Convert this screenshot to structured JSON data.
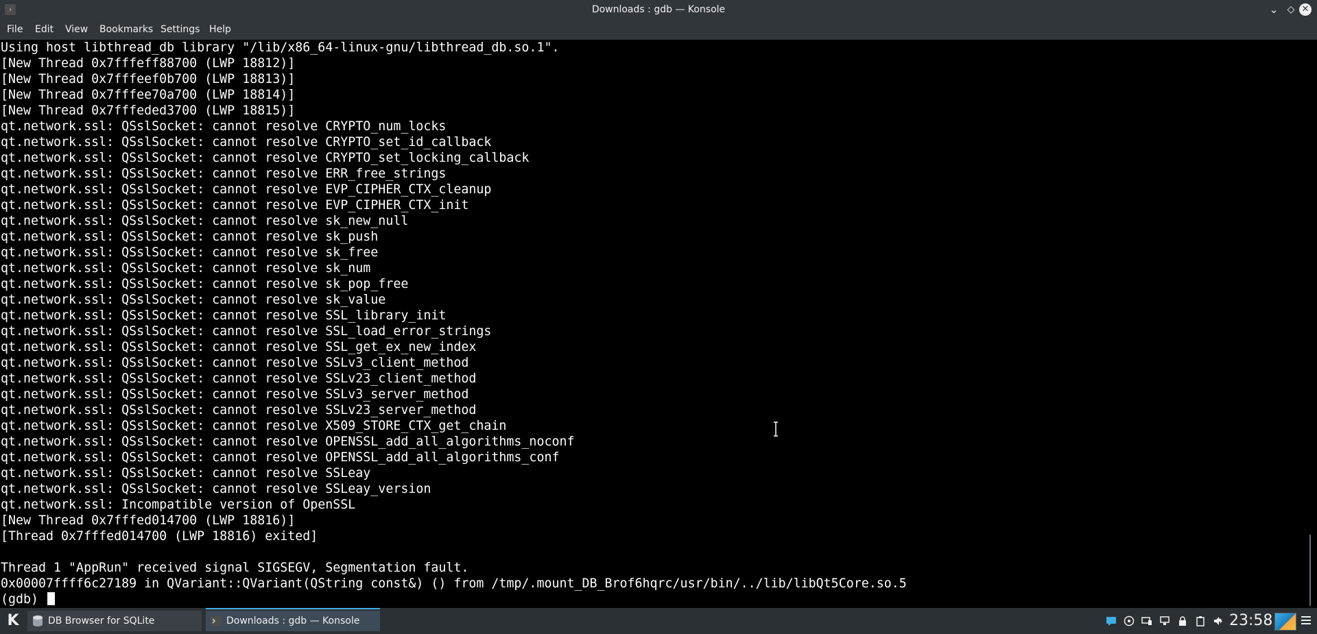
{
  "window": {
    "title": "Downloads : gdb — Konsole",
    "app_icon": "terminal-icon",
    "minimize_glyph": "⌄",
    "maximize_glyph": "◇",
    "close_glyph": "✕"
  },
  "menubar": {
    "items": [
      "File",
      "Edit",
      "View",
      "Bookmarks",
      "Settings",
      "Help"
    ]
  },
  "terminal": {
    "lines": [
      "Using host libthread_db library \"/lib/x86_64-linux-gnu/libthread_db.so.1\".",
      "[New Thread 0x7fffeff88700 (LWP 18812)]",
      "[New Thread 0x7fffeef0b700 (LWP 18813)]",
      "[New Thread 0x7fffee70a700 (LWP 18814)]",
      "[New Thread 0x7fffeded3700 (LWP 18815)]",
      "qt.network.ssl: QSslSocket: cannot resolve CRYPTO_num_locks",
      "qt.network.ssl: QSslSocket: cannot resolve CRYPTO_set_id_callback",
      "qt.network.ssl: QSslSocket: cannot resolve CRYPTO_set_locking_callback",
      "qt.network.ssl: QSslSocket: cannot resolve ERR_free_strings",
      "qt.network.ssl: QSslSocket: cannot resolve EVP_CIPHER_CTX_cleanup",
      "qt.network.ssl: QSslSocket: cannot resolve EVP_CIPHER_CTX_init",
      "qt.network.ssl: QSslSocket: cannot resolve sk_new_null",
      "qt.network.ssl: QSslSocket: cannot resolve sk_push",
      "qt.network.ssl: QSslSocket: cannot resolve sk_free",
      "qt.network.ssl: QSslSocket: cannot resolve sk_num",
      "qt.network.ssl: QSslSocket: cannot resolve sk_pop_free",
      "qt.network.ssl: QSslSocket: cannot resolve sk_value",
      "qt.network.ssl: QSslSocket: cannot resolve SSL_library_init",
      "qt.network.ssl: QSslSocket: cannot resolve SSL_load_error_strings",
      "qt.network.ssl: QSslSocket: cannot resolve SSL_get_ex_new_index",
      "qt.network.ssl: QSslSocket: cannot resolve SSLv3_client_method",
      "qt.network.ssl: QSslSocket: cannot resolve SSLv23_client_method",
      "qt.network.ssl: QSslSocket: cannot resolve SSLv3_server_method",
      "qt.network.ssl: QSslSocket: cannot resolve SSLv23_server_method",
      "qt.network.ssl: QSslSocket: cannot resolve X509_STORE_CTX_get_chain",
      "qt.network.ssl: QSslSocket: cannot resolve OPENSSL_add_all_algorithms_noconf",
      "qt.network.ssl: QSslSocket: cannot resolve OPENSSL_add_all_algorithms_conf",
      "qt.network.ssl: QSslSocket: cannot resolve SSLeay",
      "qt.network.ssl: QSslSocket: cannot resolve SSLeay_version",
      "qt.network.ssl: Incompatible version of OpenSSL",
      "[New Thread 0x7fffed014700 (LWP 18816)]",
      "[Thread 0x7fffed014700 (LWP 18816) exited]",
      "",
      "Thread 1 \"AppRun\" received signal SIGSEGV, Segmentation fault.",
      "0x00007ffff6c27189 in QVariant::QVariant(QString const&) () from /tmp/.mount_DB_Brof6hqrc/usr/bin/../lib/libQt5Core.so.5"
    ],
    "prompt": "(gdb) ",
    "text_color": "#fcfcfc",
    "background": "#000000"
  },
  "taskbar": {
    "launcher_glyph": "K",
    "tasks": [
      {
        "label": "DB Browser for SQLite",
        "icon": "database-icon",
        "active": false
      },
      {
        "label": "Downloads : gdb — Konsole",
        "icon": "terminal-icon",
        "active": true
      }
    ],
    "tray_icons": [
      "notification-icon",
      "network-globe-icon",
      "display-icon",
      "network-icon",
      "lock-icon",
      "clipboard-icon",
      "volume-icon",
      "expand-tray-icon"
    ],
    "clock": "23:58",
    "accent": "#3daee9"
  }
}
